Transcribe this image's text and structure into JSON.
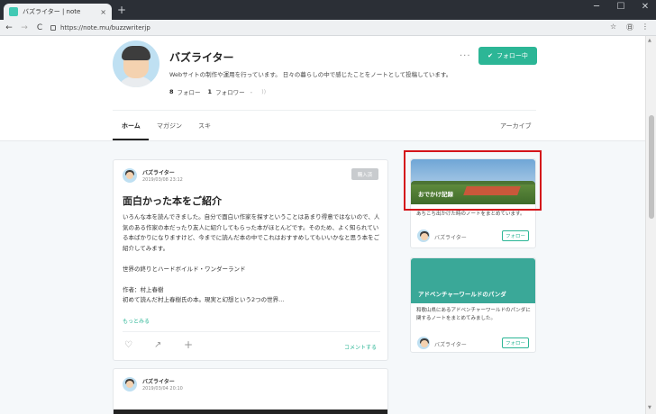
{
  "browser": {
    "tab_title": "バズライター | note",
    "tab_close": "×",
    "new_tab": "+",
    "window_controls": [
      "─",
      "☐",
      "✕"
    ],
    "nav": [
      "←",
      "→",
      "C"
    ],
    "url": "https://note.mu/buzzwriterjp",
    "toolbar_right": [
      "☆",
      "㊐",
      "⋮"
    ]
  },
  "profile": {
    "name": "バズライター",
    "description": "Webサイトの制作や運用を行っています。 日々の暮らしの中で感じたことをノートとして投稿しています。",
    "following_count": "8",
    "following_label": "フォロー",
    "followers_count": "1",
    "followers_label": "フォロワー",
    "bullet": "・",
    "rss_icon": "))",
    "more_label": "···",
    "follow_button": "フォロー中"
  },
  "nav_tabs": [
    "ホーム",
    "マガジン",
    "スキ",
    "アーカイブ"
  ],
  "article1": {
    "author": "バズライター",
    "date": "2019/03/08 23:12",
    "badge": "購入済",
    "title": "面白かった本をご紹介",
    "paragraphs": [
      "いろんな本を読んできました。自分で面白い作家を探すということはあまり得意ではないので、人気のある作家の本だったり友人に紹介してもらった本がほとんどです。そのため、よく知られている本ばかりになりますけど、今までに読んだ本の中でこれはおすすめしてもいいかなと思う本をご紹介してみます。",
      "世界の終りとハードボイルド・ワンダーランド",
      "作者：村上春樹\n初めて読んだ村上春樹氏の本。現実と幻想という2つの世界..."
    ],
    "read_more": "もっとみる",
    "like_icon": "♡",
    "share_icon": "↗",
    "add_icon": "+",
    "comment": "コメントする"
  },
  "article2": {
    "author": "バズライター",
    "date": "2019/03/04 20:10"
  },
  "magazines": [
    {
      "cover_title": "おでかけ記録",
      "description": "あちこち出かけた時のノートをまとめています。",
      "author": "バズライター",
      "follow": "フォロー"
    },
    {
      "cover_title": "アドベンチャーワールドのパンダ",
      "description": "和歌山県にあるアドベンチャーワールドのパンダに関するノートをまとめてみました。",
      "author": "バズライター",
      "follow": "フォロー"
    }
  ],
  "colors": {
    "accent": "#2cb696",
    "highlight": "#d4141a",
    "mag_green": "#3aa898"
  }
}
